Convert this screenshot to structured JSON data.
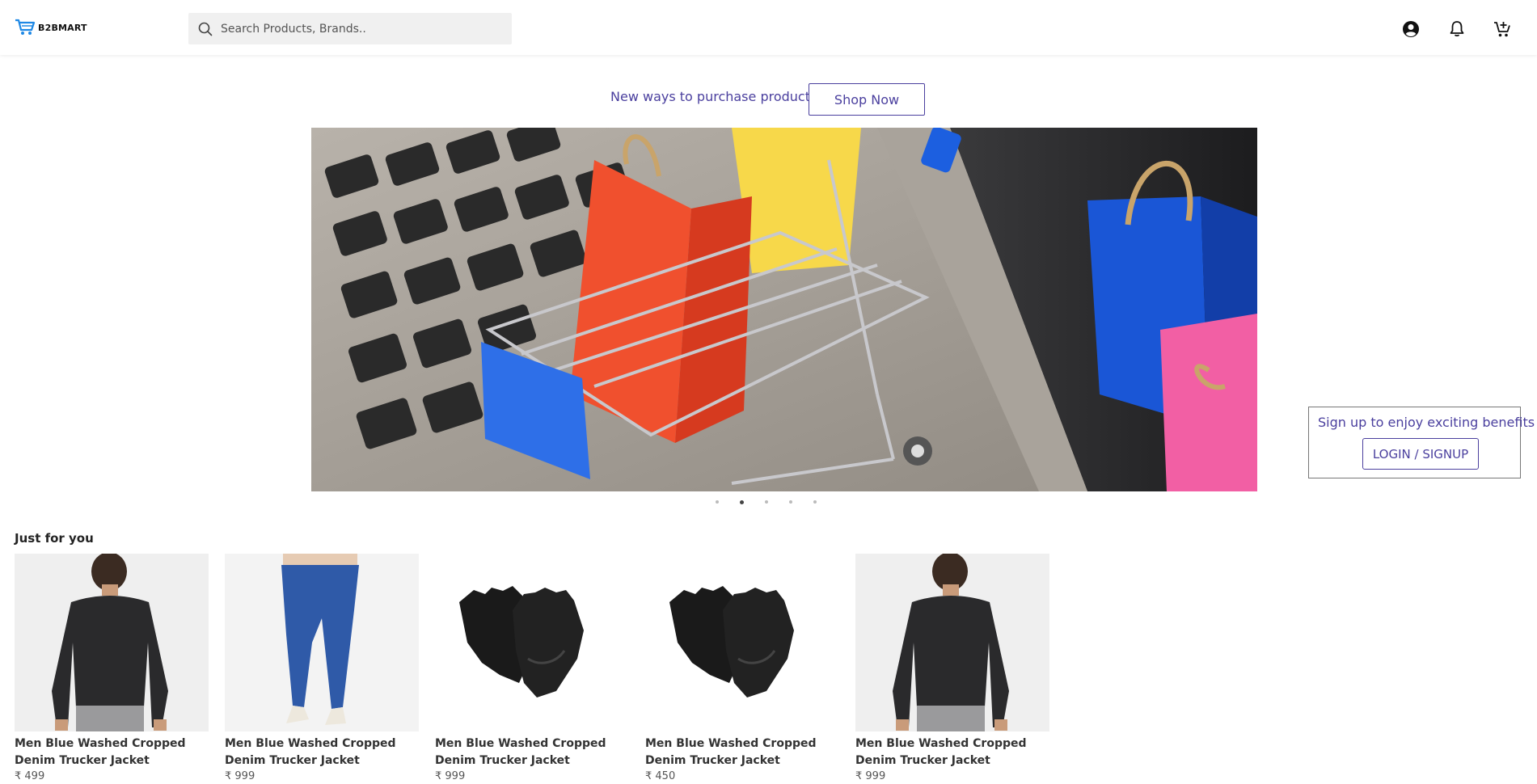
{
  "header": {
    "logo_text": "B2BMART",
    "search_placeholder": "Search Products, Brands..",
    "icons": [
      "account-icon",
      "bell-icon",
      "cart-icon"
    ]
  },
  "promo": {
    "text": "New ways to purchase products",
    "button": "Shop Now"
  },
  "carousel": {
    "slide_count": 5,
    "active_index": 1
  },
  "signup": {
    "text": "Sign up to enjoy exciting benefits",
    "button": "LOGIN / SIGNUP"
  },
  "just_for_you": {
    "title": "Just for you",
    "products": [
      {
        "name": "Men Blue Washed Cropped Denim Trucker Jacket",
        "price": "₹ 499",
        "image": "black-jacket"
      },
      {
        "name": "Men Blue Washed Cropped Denim Trucker Jacket",
        "price": "₹ 999",
        "image": "blue-jeans"
      },
      {
        "name": "Men Blue Washed Cropped Denim Trucker Jacket",
        "price": "₹ 999",
        "image": "black-gloves"
      },
      {
        "name": "Men Blue Washed Cropped Denim Trucker Jacket",
        "price": "₹ 450",
        "image": "black-gloves"
      },
      {
        "name": "Men Blue Washed Cropped Denim Trucker Jacket",
        "price": "₹ 999",
        "image": "black-jacket"
      }
    ]
  },
  "colors": {
    "accent": "#4a3f9e",
    "logo_cart": "#1e88e5"
  }
}
